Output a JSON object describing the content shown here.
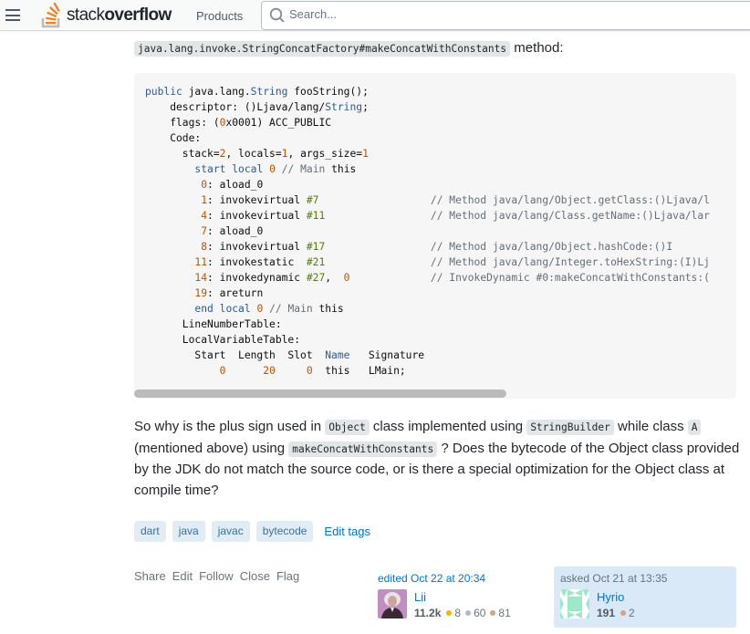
{
  "header": {
    "menu_icon": "hamburger-icon",
    "logo_text_light": "stack",
    "logo_text_bold": "overflow",
    "products_label": "Products",
    "search_placeholder": "Search..."
  },
  "intro": {
    "code": "java.lang.invoke.StringConcatFactory#makeConcatWithConstants",
    "text": " method:"
  },
  "code_lines": [
    "public java.lang.String fooString();",
    "    descriptor: ()Ljava/lang/String;",
    "    flags: (0x0001) ACC_PUBLIC",
    "    Code:",
    "      stack=2, locals=1, args_size=1",
    "        start local 0 // Main this",
    "         0: aload_0",
    "         1: invokevirtual #7                  // Method java/lang/Object.getClass:()Ljava/l",
    "         4: invokevirtual #11                 // Method java/lang/Class.getName:()Ljava/lar",
    "         7: aload_0",
    "         8: invokevirtual #17                 // Method java/lang/Object.hashCode:()I",
    "        11: invokestatic  #21                 // Method java/lang/Integer.toHexString:(I)Lj",
    "        14: invokedynamic #27,  0             // InvokeDynamic #0:makeConcatWithConstants:(",
    "        19: areturn",
    "        end local 0 // Main this",
    "      LineNumberTable:",
    "      LocalVariableTable:",
    "        Start  Length  Slot  Name   Signature",
    "            0      20     0  this   LMain;"
  ],
  "question": {
    "p1": "So why is the plus sign used in ",
    "c1": "Object",
    "p2": " class implemented using ",
    "c2": "StringBuilder",
    "p3": " while class ",
    "c3": "A",
    "p4": " (mentioned above) using ",
    "c4": "makeConcatWithConstants",
    "p5": " ? Does the bytecode of the Object class provided by the JDK do not match the source code, or is there a special optimization for the Object class at compile time?"
  },
  "tags": [
    "dart",
    "java",
    "javac",
    "bytecode"
  ],
  "edit_tags_label": "Edit tags",
  "post_menu": [
    "Share",
    "Edit",
    "Follow",
    "Close",
    "Flag"
  ],
  "editor": {
    "action": "edited Oct 22 at 20:34",
    "name": "Lii",
    "reputation": "11.2k",
    "gold": "8",
    "silver": "60",
    "bronze": "81"
  },
  "asker": {
    "action": "asked Oct 21 at 13:35",
    "name": "Hyrio",
    "reputation": "191",
    "bronze": "2"
  }
}
